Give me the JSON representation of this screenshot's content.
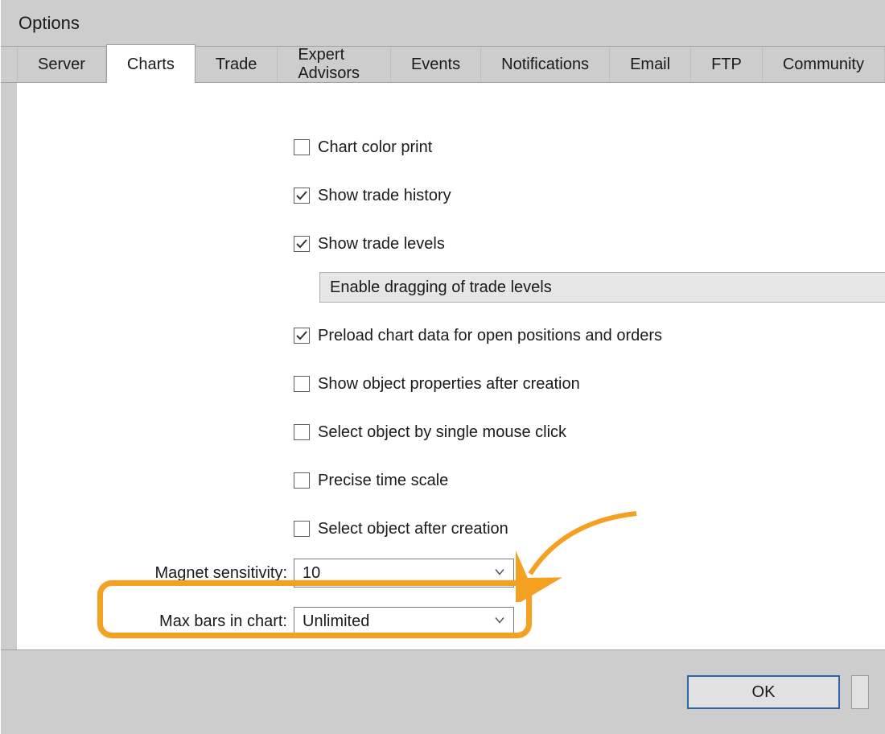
{
  "window": {
    "title": "Options"
  },
  "tabs": [
    {
      "label": "Server"
    },
    {
      "label": "Charts"
    },
    {
      "label": "Trade"
    },
    {
      "label": "Expert Advisors"
    },
    {
      "label": "Events"
    },
    {
      "label": "Notifications"
    },
    {
      "label": "Email"
    },
    {
      "label": "FTP"
    },
    {
      "label": "Community"
    }
  ],
  "active_tab_index": 1,
  "charts_tab": {
    "chart_color_print": {
      "label": "Chart color print",
      "checked": false
    },
    "show_trade_history": {
      "label": "Show trade history",
      "checked": true
    },
    "show_trade_levels": {
      "label": "Show trade levels",
      "checked": true
    },
    "enable_dragging": {
      "label": "Enable dragging of trade levels"
    },
    "preload_chart_data": {
      "label": "Preload chart data for open positions and orders",
      "checked": true
    },
    "show_object_props": {
      "label": "Show object properties after creation",
      "checked": false
    },
    "select_single_click": {
      "label": "Select object by single mouse click",
      "checked": false
    },
    "precise_time_scale": {
      "label": "Precise time scale",
      "checked": false
    },
    "select_after_creation": {
      "label": "Select object after creation",
      "checked": false
    },
    "magnet_sensitivity": {
      "label": "Magnet sensitivity:",
      "value": "10"
    },
    "max_bars": {
      "label": "Max bars in chart:",
      "value": "Unlimited"
    }
  },
  "buttons": {
    "ok": "OK"
  },
  "colors": {
    "highlight": "#f4a021",
    "primary": "#2b66a8"
  }
}
